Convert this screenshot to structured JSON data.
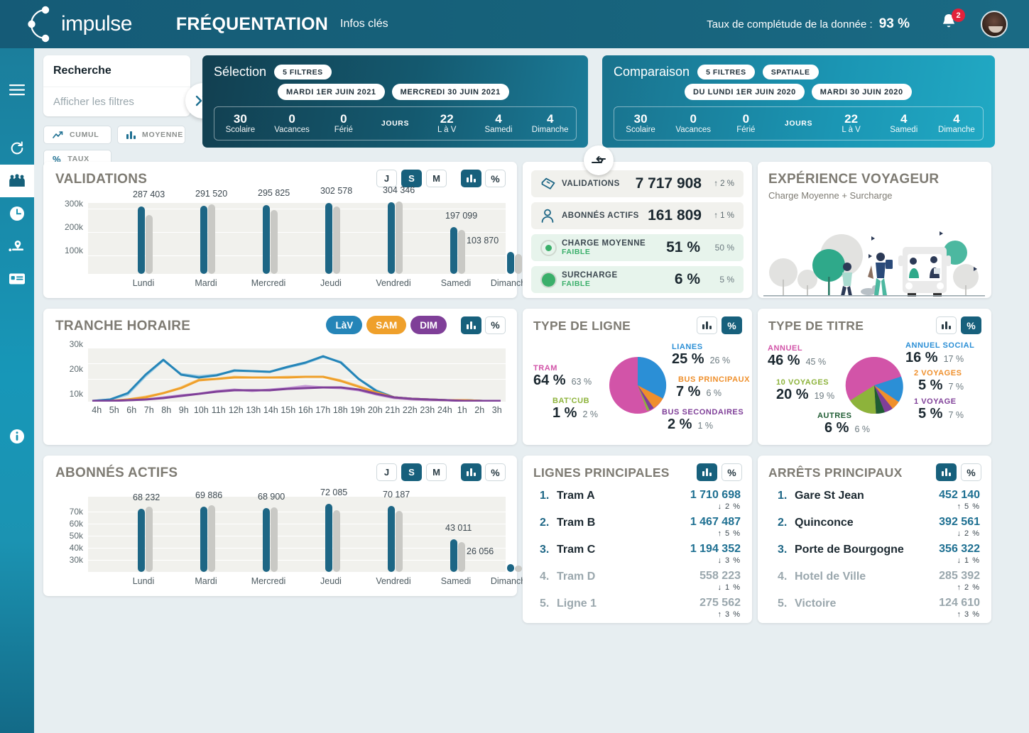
{
  "header": {
    "logo_text": "impulse",
    "title": "FRÉQUENTATION",
    "subtitle": "Infos clés",
    "completude_label": "Taux de complétude de la donnée :",
    "completude_value": "93 %",
    "notification_count": "2"
  },
  "sidebar": {
    "items": [
      {
        "name": "menu-icon",
        "label": "Menu"
      },
      {
        "name": "refresh-icon",
        "label": "Actualiser"
      },
      {
        "name": "people-icon",
        "label": "Fréquentation"
      },
      {
        "name": "clock-icon",
        "label": "Horaires"
      },
      {
        "name": "location-icon",
        "label": "Localisation"
      },
      {
        "name": "card-icon",
        "label": "Titres"
      },
      {
        "name": "info-icon",
        "label": "Informations"
      }
    ]
  },
  "search": {
    "placeholder": "Recherche",
    "value": "",
    "filters_label": "Afficher les filtres",
    "expand_label": "»",
    "buttons": [
      {
        "label": "CUMUL",
        "icon": "trend-icon"
      },
      {
        "label": "MOYENNE",
        "icon": "bars-icon"
      },
      {
        "label": "TAUX",
        "icon": "percent-icon"
      }
    ]
  },
  "selection": {
    "title": "Sélection",
    "pills": [
      "5 FILTRES"
    ],
    "dates": [
      "MARDI 1ER JUIN 2021",
      "MERCREDI 30 JUIN 2021"
    ],
    "stats": [
      {
        "value": "30",
        "label": "Scolaire"
      },
      {
        "value": "0",
        "label": "Vacances"
      },
      {
        "value": "0",
        "label": "Férié"
      },
      {
        "value": "JOURS",
        "label": ""
      },
      {
        "value": "22",
        "label": "L à V"
      },
      {
        "value": "4",
        "label": "Samedi"
      },
      {
        "value": "4",
        "label": "Dimanche"
      }
    ]
  },
  "comparison": {
    "title": "Comparaison",
    "pills": [
      "5 FILTRES",
      "SPATIALE"
    ],
    "dates": [
      "DU LUNDI 1ER JUIN 2020",
      "MARDI 30 JUIN 2020"
    ],
    "stats": [
      {
        "value": "30",
        "label": "Scolaire"
      },
      {
        "value": "0",
        "label": "Vacances"
      },
      {
        "value": "0",
        "label": "Férié"
      },
      {
        "value": "JOURS",
        "label": ""
      },
      {
        "value": "22",
        "label": "L à V"
      },
      {
        "value": "4",
        "label": "Samedi"
      },
      {
        "value": "4",
        "label": "Dimanche"
      }
    ]
  },
  "swap_button": {
    "name": "swap-selection-comparison",
    "label": "⇄"
  },
  "validations_card": {
    "title": "VALIDATIONS",
    "period_toggles": [
      {
        "label": "J",
        "active": false
      },
      {
        "label": "S",
        "active": true
      },
      {
        "label": "M",
        "active": false
      }
    ],
    "view_toggles": [
      {
        "label": "bars-icon",
        "active": true
      },
      {
        "label": "%",
        "active": false
      }
    ]
  },
  "abonnes_card": {
    "title": "ABONNÉS ACTIFS",
    "period_toggles": [
      {
        "label": "J",
        "active": false
      },
      {
        "label": "S",
        "active": true
      },
      {
        "label": "M",
        "active": false
      }
    ],
    "view_toggles": [
      {
        "label": "bars-icon",
        "active": true
      },
      {
        "label": "%",
        "active": false
      }
    ]
  },
  "tranche_card": {
    "title": "TRANCHE HORAIRE",
    "legend": [
      {
        "label": "LàV",
        "color": "#2585b8"
      },
      {
        "label": "SAM",
        "color": "#efa02b"
      },
      {
        "label": "DIM",
        "color": "#7f3f98"
      }
    ],
    "view_toggles": [
      {
        "label": "bars-icon",
        "active": true
      },
      {
        "label": "%",
        "active": false
      }
    ]
  },
  "kpis": [
    {
      "icon": "ticket-icon",
      "name": "VALIDATIONS",
      "value": "7 717 908",
      "arrow": "↑",
      "delta": "2 %",
      "style": "grey"
    },
    {
      "icon": "user-icon",
      "name": "ABONNÉS ACTIFS",
      "value": "161 809",
      "arrow": "↑",
      "delta": "1 %",
      "style": "grey"
    },
    {
      "icon": "dot-small-icon",
      "name": "CHARGE MOYENNE",
      "sub": "FAIBLE",
      "value": "51 %",
      "compare": "50 %",
      "style": "green"
    },
    {
      "icon": "dot-large-icon",
      "name": "SURCHARGE",
      "sub": "FAIBLE",
      "value": "6 %",
      "compare": "5 %",
      "style": "green"
    }
  ],
  "experience_card": {
    "title": "EXPÉRIENCE VOYAGEUR",
    "subtitle": "Charge Moyenne + Surcharge"
  },
  "type_ligne_card": {
    "title": "TYPE DE LIGNE",
    "view_toggles": [
      {
        "label": "bars-icon",
        "active": false
      },
      {
        "label": "%",
        "active": true
      }
    ]
  },
  "type_titre_card": {
    "title": "TYPE DE TITRE",
    "view_toggles": [
      {
        "label": "bars-icon",
        "active": false
      },
      {
        "label": "%",
        "active": true
      }
    ]
  },
  "lignes_card": {
    "title": "LIGNES PRINCIPALES",
    "view_toggles": [
      {
        "label": "bars-icon",
        "active": true
      },
      {
        "label": "%",
        "active": false
      }
    ],
    "rows": [
      {
        "rank": "1.",
        "name": "Tram A",
        "value": "1 710 698",
        "arrow": "↓",
        "delta": "2 %",
        "dim": false
      },
      {
        "rank": "2.",
        "name": "Tram B",
        "value": "1 467 487",
        "arrow": "↑",
        "delta": "5 %",
        "dim": false
      },
      {
        "rank": "3.",
        "name": "Tram C",
        "value": "1 194 352",
        "arrow": "↓",
        "delta": "3 %",
        "dim": false
      },
      {
        "rank": "4.",
        "name": "Tram D",
        "value": "558 223",
        "arrow": "↓",
        "delta": "1 %",
        "dim": true
      },
      {
        "rank": "5.",
        "name": "Ligne 1",
        "value": "275 562",
        "arrow": "↑",
        "delta": "3 %",
        "dim": true
      }
    ]
  },
  "arrets_card": {
    "title": "ARRÊTS PRINCIPAUX",
    "view_toggles": [
      {
        "label": "bars-icon",
        "active": true
      },
      {
        "label": "%",
        "active": false
      }
    ],
    "rows": [
      {
        "rank": "1.",
        "name": "Gare St Jean",
        "value": "452 140",
        "arrow": "↑",
        "delta": "5 %",
        "dim": false
      },
      {
        "rank": "2.",
        "name": "Quinconce",
        "value": "392 561",
        "arrow": "↓",
        "delta": "2 %",
        "dim": false
      },
      {
        "rank": "3.",
        "name": "Porte de Bourgogne",
        "value": "356 322",
        "arrow": "↓",
        "delta": "1 %",
        "dim": false
      },
      {
        "rank": "4.",
        "name": "Hotel de Ville",
        "value": "285 392",
        "arrow": "↑",
        "delta": "2 %",
        "dim": true
      },
      {
        "rank": "5.",
        "name": "Victoire",
        "value": "124 610",
        "arrow": "↑",
        "delta": "3 %",
        "dim": true
      }
    ]
  },
  "chart_data": [
    {
      "type": "bar",
      "id": "validations",
      "title": "VALIDATIONS",
      "categories": [
        "Lundi",
        "Mardi",
        "Mercredi",
        "Jeudi",
        "Vendredi",
        "Samedi",
        "Dimanche"
      ],
      "ylabel": "",
      "xlabel": "",
      "ylim": [
        0,
        340000
      ],
      "yticks": [
        100000,
        200000,
        300000
      ],
      "ytick_labels": [
        "100k",
        "200k",
        "300k"
      ],
      "grid": true,
      "series": [
        {
          "name": "Sélection",
          "color": "#1d6685",
          "values": [
            287403,
            291520,
            295825,
            302578,
            304346,
            197099,
            103870
          ],
          "labels": [
            "287 403",
            "291 520",
            "295 825",
            "302 578",
            "304 346",
            "197 099",
            "103 870"
          ]
        },
        {
          "name": "Comparaison",
          "color": "#c9c9c5",
          "values": [
            262000,
            298000,
            275000,
            288000,
            308000,
            185000,
            98000
          ]
        }
      ]
    },
    {
      "type": "line",
      "id": "tranche-horaire",
      "title": "TRANCHE HORAIRE",
      "x": [
        "4h",
        "5h",
        "6h",
        "7h",
        "8h",
        "9h",
        "10h",
        "11h",
        "12h",
        "13h",
        "14h",
        "15h",
        "16h",
        "17h",
        "18h",
        "19h",
        "20h",
        "21h",
        "22h",
        "23h",
        "24h",
        "1h",
        "2h",
        "3h"
      ],
      "ylim": [
        0,
        34000
      ],
      "yticks": [
        10000,
        20000,
        30000
      ],
      "ytick_labels": [
        "10k",
        "20k",
        "30k"
      ],
      "grid": true,
      "series": [
        {
          "name": "LàV",
          "color": "#2585b8",
          "values": [
            400,
            900,
            5200,
            16500,
            26500,
            17200,
            15600,
            16900,
            19600,
            19200,
            18900,
            21600,
            24200,
            28500,
            24200,
            13900,
            6300,
            2200,
            1500,
            1200,
            900,
            700,
            600,
            500
          ]
        },
        {
          "name": "LàV comparaison",
          "color": "#9fcde4",
          "values": [
            400,
            900,
            4200,
            15800,
            26000,
            17600,
            16300,
            17200,
            19100,
            19000,
            18700,
            21200,
            23900,
            28000,
            25000,
            14600,
            6600,
            2300,
            1500,
            1200,
            900,
            700,
            600,
            500
          ]
        },
        {
          "name": "SAM",
          "color": "#efa02b",
          "values": [
            200,
            400,
            900,
            2500,
            5100,
            8200,
            12900,
            13900,
            14900,
            15100,
            15100,
            15200,
            15300,
            15500,
            13100,
            9500,
            5600,
            2400,
            1700,
            1300,
            1000,
            800,
            700,
            600
          ]
        },
        {
          "name": "SAM comparaison",
          "color": "#f7c97e",
          "values": [
            200,
            400,
            1100,
            2900,
            5500,
            8700,
            13400,
            14100,
            15300,
            15000,
            15000,
            15100,
            15200,
            15400,
            13500,
            9800,
            5800,
            2500,
            1700,
            1300,
            1000,
            800,
            700,
            600
          ]
        },
        {
          "name": "DIM",
          "color": "#7f3f98",
          "values": [
            200,
            300,
            500,
            1000,
            1900,
            3000,
            4400,
            6000,
            6900,
            6800,
            7000,
            7600,
            8100,
            8400,
            8400,
            7100,
            4700,
            2100,
            1400,
            1100,
            900,
            700,
            600,
            500
          ]
        },
        {
          "name": "DIM comparaison",
          "color": "#c59ad5",
          "values": [
            200,
            300,
            500,
            1100,
            2100,
            3300,
            4700,
            6300,
            7200,
            6400,
            7300,
            8000,
            9200,
            8700,
            8300,
            7000,
            4600,
            2100,
            1400,
            1100,
            900,
            700,
            600,
            500
          ]
        }
      ]
    },
    {
      "type": "bar",
      "id": "abonnes-actifs",
      "title": "ABONNÉS ACTIFS",
      "categories": [
        "Lundi",
        "Mardi",
        "Mercredi",
        "Jeudi",
        "Vendredi",
        "Samedi",
        "Dimanche"
      ],
      "ylim": [
        0,
        76000
      ],
      "yticks": [
        30000,
        40000,
        50000,
        60000,
        70000
      ],
      "ytick_labels": [
        "30k",
        "40k",
        "50k",
        "60k",
        "70k"
      ],
      "grid": true,
      "series": [
        {
          "name": "Sélection",
          "color": "#1d6685",
          "values": [
            68232,
            69886,
            68900,
            72085,
            70187,
            43011,
            26056
          ],
          "labels": [
            "68 232",
            "69 886",
            "68 900",
            "72 085",
            "70 187",
            "43 011",
            "26 056"
          ]
        },
        {
          "name": "Comparaison",
          "color": "#c9c9c5",
          "values": [
            70200,
            71500,
            69300,
            67800,
            67100,
            41800,
            25100
          ]
        }
      ]
    },
    {
      "type": "pie",
      "id": "type-de-ligne",
      "title": "TYPE DE LIGNE",
      "slices": [
        {
          "label": "TRAM",
          "value": 64,
          "compare": 63,
          "color": "#d254a8",
          "value_text": "64 %",
          "compare_text": "63 %"
        },
        {
          "label": "LIANES",
          "value": 25,
          "compare": 26,
          "color": "#2b8fd6",
          "value_text": "25 %",
          "compare_text": "26 %"
        },
        {
          "label": "BUS PRINCIPAUX",
          "value": 7,
          "compare": 6,
          "color": "#ef8f2b",
          "value_text": "7 %",
          "compare_text": "6 %"
        },
        {
          "label": "BUS SECONDAIRES",
          "value": 2,
          "compare": 1,
          "color": "#7f3f98",
          "value_text": "2 %",
          "compare_text": "1 %"
        },
        {
          "label": "BAT'CUB",
          "value": 1,
          "compare": 2,
          "color": "#8db33b",
          "value_text": "1 %",
          "compare_text": "2 %"
        }
      ]
    },
    {
      "type": "pie",
      "id": "type-de-titre",
      "title": "TYPE DE TITRE",
      "slices": [
        {
          "label": "ANNUEL",
          "value": 46,
          "compare": 45,
          "color": "#d254a8",
          "value_text": "46 %",
          "compare_text": "45 %"
        },
        {
          "label": "ANNUEL SOCIAL",
          "value": 16,
          "compare": 17,
          "color": "#2b8fd6",
          "value_text": "16 %",
          "compare_text": "17 %"
        },
        {
          "label": "2 VOYAGES",
          "value": 5,
          "compare": 7,
          "color": "#ef8f2b",
          "value_text": "5 %",
          "compare_text": "7 %"
        },
        {
          "label": "1 VOYAGE",
          "value": 5,
          "compare": 7,
          "color": "#7f3f98",
          "value_text": "5 %",
          "compare_text": "7 %"
        },
        {
          "label": "AUTRES",
          "value": 6,
          "compare": 6,
          "color": "#1f5c33",
          "value_text": "6 %",
          "compare_text": "6 %"
        },
        {
          "label": "10 VOYAGES",
          "value": 20,
          "compare": 19,
          "color": "#8db33b",
          "value_text": "20 %",
          "compare_text": "19 %"
        }
      ]
    }
  ]
}
